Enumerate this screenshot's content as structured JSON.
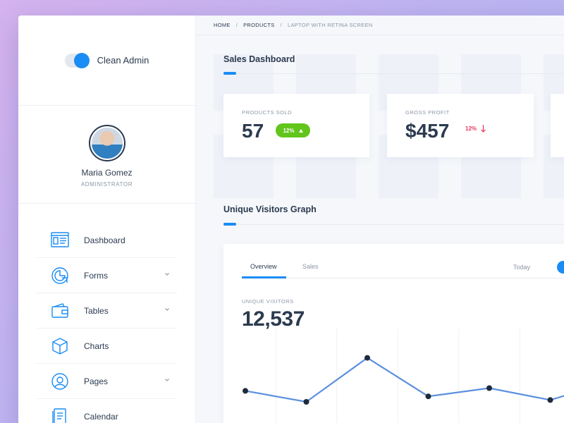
{
  "brand": {
    "name": "Clean Admin"
  },
  "user": {
    "name": "Maria Gomez",
    "role": "ADMINISTRATOR"
  },
  "nav": [
    {
      "label": "Dashboard",
      "icon": "dashboard-icon",
      "has_children": false
    },
    {
      "label": "Forms",
      "icon": "forms-icon",
      "has_children": true
    },
    {
      "label": "Tables",
      "icon": "tables-icon",
      "has_children": true
    },
    {
      "label": "Charts",
      "icon": "charts-icon",
      "has_children": false
    },
    {
      "label": "Pages",
      "icon": "pages-icon",
      "has_children": true
    },
    {
      "label": "Calendar",
      "icon": "calendar-icon",
      "has_children": false
    }
  ],
  "breadcrumb": {
    "home": "HOME",
    "section": "PRODUCTS",
    "current": "LAPTOP WITH RETINA SCREEN"
  },
  "sales": {
    "title": "Sales Dashboard",
    "products_sold": {
      "label": "PRODUCTS SOLD",
      "value": "57",
      "change": "12%",
      "trend": "up"
    },
    "gross_profit": {
      "label": "GROSS PROFIT",
      "value": "$457",
      "change": "12%",
      "trend": "down"
    }
  },
  "visitors": {
    "title": "Unique Visitors Graph",
    "tabs": [
      "Overview",
      "Sales"
    ],
    "active_tab": "Overview",
    "range_label": "Today",
    "metric_label": "UNIQUE VISITORS",
    "metric_value": "12,537"
  },
  "chart_data": {
    "type": "line",
    "x": [
      1,
      2,
      3,
      4,
      5,
      6,
      7
    ],
    "values": [
      52,
      40,
      88,
      46,
      55,
      42,
      62
    ],
    "ylim": [
      0,
      120
    ],
    "grid": "vertical",
    "color": "#5b8fdf"
  },
  "colors": {
    "accent": "#1a8cf5",
    "positive": "#62c51c",
    "negative": "#e8365d",
    "text": "#2b3a4f",
    "muted": "#8c97a6"
  }
}
